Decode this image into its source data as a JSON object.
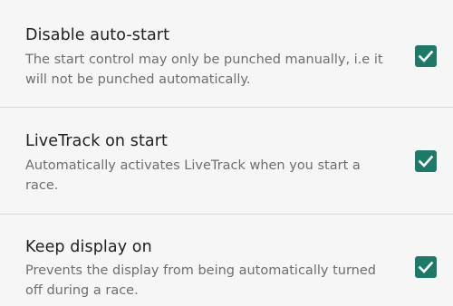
{
  "settings": {
    "items": [
      {
        "title": "Disable auto-start",
        "description": "The start control may only be punched manually, i.e it will not be punched automatically.",
        "checked": true
      },
      {
        "title": "LiveTrack on start",
        "description": "Automatically activates LiveTrack when you start a race.",
        "checked": true
      },
      {
        "title": "Keep display on",
        "description": "Prevents the display from being automatically turned off during a race.",
        "checked": true
      }
    ]
  },
  "colors": {
    "background": "#f6f6f6",
    "checkbox": "#1d7a68",
    "title": "#212121",
    "description": "#6e6e6e",
    "divider": "#dadada"
  },
  "icons": {
    "checkbox": "check-icon"
  }
}
